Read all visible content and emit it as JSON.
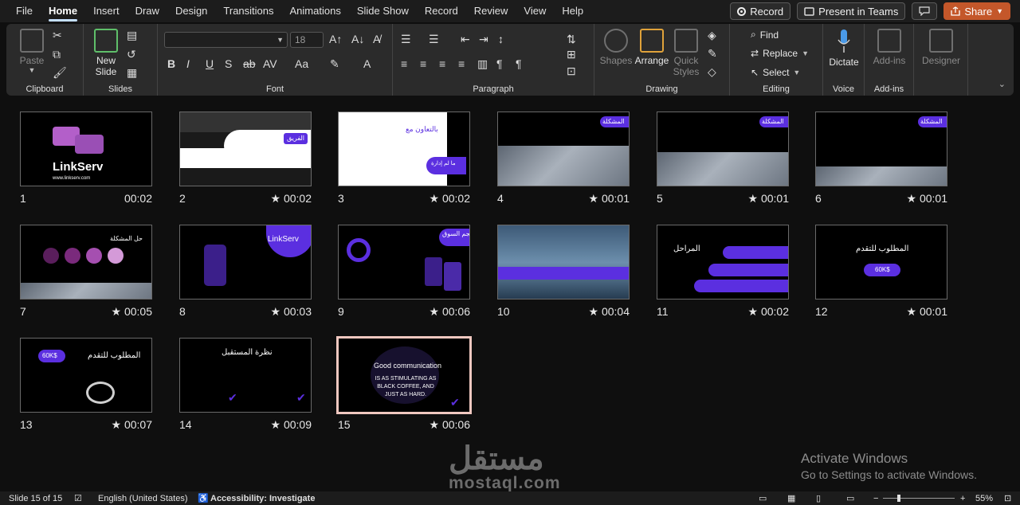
{
  "menu": {
    "tabs": [
      "File",
      "Home",
      "Insert",
      "Draw",
      "Design",
      "Transitions",
      "Animations",
      "Slide Show",
      "Record",
      "Review",
      "View",
      "Help"
    ],
    "active_tab": "Home",
    "record_label": "Record",
    "present_label": "Present in Teams",
    "share_label": "Share"
  },
  "ribbon": {
    "clipboard": {
      "label": "Clipboard",
      "paste": "Paste"
    },
    "slides": {
      "label": "Slides",
      "new_slide": "New Slide"
    },
    "font": {
      "label": "Font",
      "size": "18"
    },
    "paragraph": {
      "label": "Paragraph"
    },
    "drawing": {
      "label": "Drawing",
      "shapes": "Shapes",
      "arrange": "Arrange",
      "quick_styles": "Quick Styles"
    },
    "editing": {
      "label": "Editing",
      "find": "Find",
      "replace": "Replace",
      "select": "Select"
    },
    "voice": {
      "label": "Voice",
      "dictate": "Dictate"
    },
    "addins": {
      "label": "Add-ins",
      "addins_button": "Add-ins"
    },
    "designer": {
      "label": "Designer"
    }
  },
  "slides": [
    {
      "num": "1",
      "time": "00:02",
      "star": false
    },
    {
      "num": "2",
      "time": "00:02",
      "star": true
    },
    {
      "num": "3",
      "time": "00:02",
      "star": true
    },
    {
      "num": "4",
      "time": "00:01",
      "star": true
    },
    {
      "num": "5",
      "time": "00:01",
      "star": true
    },
    {
      "num": "6",
      "time": "00:01",
      "star": true
    },
    {
      "num": "7",
      "time": "00:05",
      "star": true
    },
    {
      "num": "8",
      "time": "00:03",
      "star": true
    },
    {
      "num": "9",
      "time": "00:06",
      "star": true
    },
    {
      "num": "10",
      "time": "00:04",
      "star": true
    },
    {
      "num": "11",
      "time": "00:02",
      "star": true
    },
    {
      "num": "12",
      "time": "00:01",
      "star": true
    },
    {
      "num": "13",
      "time": "00:07",
      "star": true
    },
    {
      "num": "14",
      "time": "00:09",
      "star": true
    },
    {
      "num": "15",
      "time": "00:06",
      "star": true
    }
  ],
  "slide_text": {
    "s1_logo": "LinkServ",
    "s1_url": "www.linkserv.com",
    "s2_title": "الفريق",
    "s3_text": "بالتعاون مع",
    "s3_badge": "ما لم إدارة",
    "s4_badge": "المشكلة",
    "s5_badge": "المشكلة",
    "s6_badge": "المشكلة",
    "s7_title": "حل المشكلة",
    "s8_title": "LinkServ",
    "s9_title": "حجم السوق",
    "s11_title": "المراحل",
    "s12_title": "المطلوب للتقدم",
    "s12_badge": "60K$",
    "s13_title": "المطلوب للتقدم",
    "s13_badge": "60K$",
    "s14_title": "نظرة المستقبل",
    "s15_line1": "Good communication",
    "s15_line2": "IS AS STIMULATING AS BLACK COFFEE, AND JUST AS HARD."
  },
  "statusbar": {
    "slide_count": "Slide 15 of 15",
    "language": "English (United States)",
    "accessibility": "Accessibility: Investigate",
    "zoom": "55%"
  },
  "watermark": {
    "activate_title": "Activate Windows",
    "activate_sub": "Go to Settings to activate Windows.",
    "logo_arabic": "مستقل",
    "logo_latin": "mostaql.com"
  },
  "colors": {
    "accent": "#5b2fe0",
    "share": "#c4572a",
    "selected_border": "#f0c8c0"
  }
}
